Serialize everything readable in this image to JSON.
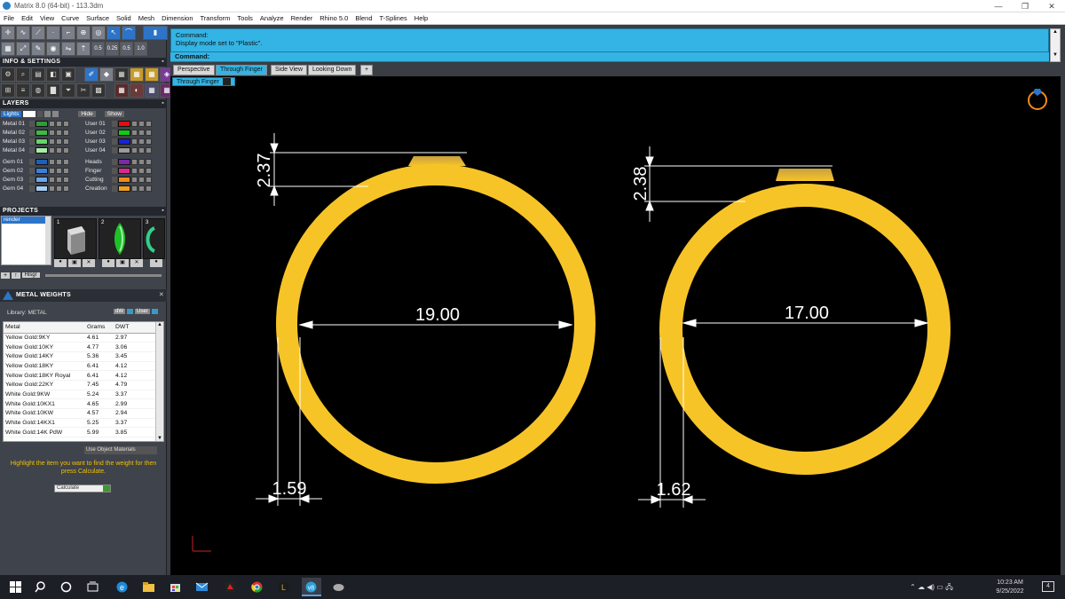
{
  "window": {
    "title": "Matrix 8.0 (64-bit) - 113.3dm",
    "controls": [
      "—",
      "❐",
      "✕"
    ]
  },
  "menu": [
    "File",
    "Edit",
    "View",
    "Curve",
    "Surface",
    "Solid",
    "Mesh",
    "Dimension",
    "Transform",
    "Tools",
    "Analyze",
    "Render",
    "Rhino 5.0",
    "Blend",
    "T-Splines",
    "Help"
  ],
  "toolbar": {
    "values": [
      "0.5",
      "0.25",
      "0.5",
      "1.0"
    ]
  },
  "sections": {
    "info": "INFO & SETTINGS",
    "layers": "LAYERS",
    "projects": "PROJECTS",
    "metal_weights": "METAL WEIGHTS"
  },
  "layers": {
    "lights_label": "Lights",
    "hide_label": "Hide",
    "show_label": "Show",
    "left": [
      {
        "name": "Metal 01",
        "color": "#2e9c3a"
      },
      {
        "name": "Metal 02",
        "color": "#3fb84a"
      },
      {
        "name": "Metal 03",
        "color": "#66d46e"
      },
      {
        "name": "Metal 04",
        "color": "#a8eea8"
      },
      {
        "name": "Gem 01",
        "color": "#1f5fb8"
      },
      {
        "name": "Gem 02",
        "color": "#3a7fd8"
      },
      {
        "name": "Gem 03",
        "color": "#6aa6ee"
      },
      {
        "name": "Gem 04",
        "color": "#a8ccf6"
      }
    ],
    "right": [
      {
        "name": "User 01",
        "color": "#e01010"
      },
      {
        "name": "User 02",
        "color": "#15c815"
      },
      {
        "name": "User 03",
        "color": "#1a22d8"
      },
      {
        "name": "User 04",
        "color": "#9a9a9a"
      },
      {
        "name": "Heads",
        "color": "#7a2aa8"
      },
      {
        "name": "Finger",
        "color": "#d82a8c"
      },
      {
        "name": "Cutting",
        "color": "#f08a1a"
      },
      {
        "name": "Creation",
        "color": "#f0a020"
      }
    ]
  },
  "projects": {
    "items": [
      "render"
    ],
    "thumb_numbers": [
      "1",
      "2",
      "3"
    ],
    "buttons": [
      "+",
      "↑",
      "Hisgr"
    ]
  },
  "metal_weights": {
    "library_label": "Library: METAL",
    "dw_label": "dW",
    "user_label": "User",
    "columns": [
      "Metal",
      "Grams",
      "DWT"
    ],
    "rows": [
      [
        "Yellow Gold:9KY",
        "4.61",
        "2.97"
      ],
      [
        "Yellow Gold:10KY",
        "4.77",
        "3.06"
      ],
      [
        "Yellow Gold:14KY",
        "5.36",
        "3.45"
      ],
      [
        "Yellow Gold:18KY",
        "6.41",
        "4.12"
      ],
      [
        "Yellow Gold:18KY Royal",
        "6.41",
        "4.12"
      ],
      [
        "Yellow Gold:22KY",
        "7.45",
        "4.79"
      ],
      [
        "White Gold:9KW",
        "5.24",
        "3.37"
      ],
      [
        "White Gold:10KX1",
        "4.65",
        "2.99"
      ],
      [
        "White Gold:10KW",
        "4.57",
        "2.94"
      ],
      [
        "White Gold:14KX1",
        "5.25",
        "3.37"
      ],
      [
        "White Gold:14K PdW",
        "5.99",
        "3.85"
      ]
    ],
    "use_object_materials": "Use Object Materials",
    "hint": "Highlight the item you want to find the weight for then press Calculate.",
    "calculate_label": "Calculate"
  },
  "command": {
    "line1": "Command:",
    "line2": "Display mode set to \"Plastic\".",
    "prompt": "Command:"
  },
  "tabs": [
    "Perspective",
    "Through Finger",
    "Side View",
    "Looking Down",
    "+"
  ],
  "active_tab": "Through Finger",
  "viewport": {
    "label": "Through Finger",
    "ring_color": "#f7c428",
    "dim_color": "#ffffff",
    "rings": [
      {
        "inner_diameter": "19.00",
        "thickness": "1.59",
        "top_height": "2.37"
      },
      {
        "inner_diameter": "17.00",
        "thickness": "1.62",
        "top_height": "2.38"
      }
    ]
  },
  "taskbar": {
    "time": "10:23 AM",
    "date": "9/25/2022",
    "notifications": "4"
  }
}
